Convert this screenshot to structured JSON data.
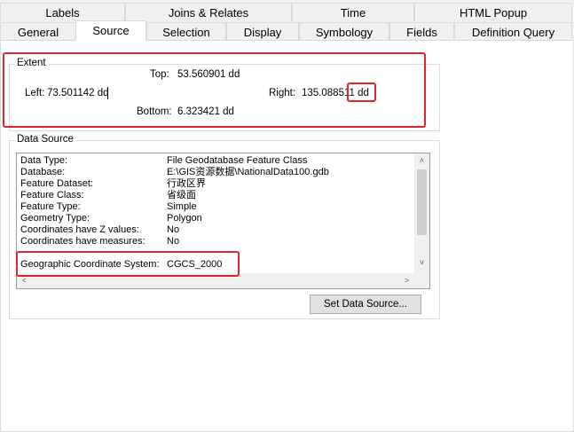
{
  "tabs_row1": [
    {
      "label": "Labels"
    },
    {
      "label": "Joins & Relates"
    },
    {
      "label": "Time"
    },
    {
      "label": "HTML Popup"
    }
  ],
  "tabs_row2": [
    {
      "label": "General"
    },
    {
      "label": "Source"
    },
    {
      "label": "Selection"
    },
    {
      "label": "Display"
    },
    {
      "label": "Symbology"
    },
    {
      "label": "Fields"
    },
    {
      "label": "Definition Query"
    }
  ],
  "active_tab": "Source",
  "extent": {
    "legend": "Extent",
    "top_label": "Top:",
    "top_value": "53.560901 dd",
    "left_label": "Left:",
    "left_value": "73.501142 dd",
    "right_label": "Right:",
    "right_value": "135.088511 dd",
    "bottom_label": "Bottom:",
    "bottom_value": "6.323421 dd"
  },
  "data_source": {
    "legend": "Data Source",
    "rows": [
      {
        "key": "Data Type:",
        "value": "File Geodatabase Feature Class"
      },
      {
        "key": "Database:",
        "value": "E:\\GIS资源数据\\NationalData100.gdb"
      },
      {
        "key": "Feature Dataset:",
        "value": "行政区界"
      },
      {
        "key": "Feature Class:",
        "value": "省级面"
      },
      {
        "key": "Feature Type:",
        "value": "Simple"
      },
      {
        "key": "Geometry Type:",
        "value": "Polygon"
      },
      {
        "key": "Coordinates have Z values:",
        "value": "No"
      },
      {
        "key": "Coordinates have measures:",
        "value": "No"
      },
      {
        "key": "Geographic Coordinate System:",
        "value": "CGCS_2000"
      }
    ],
    "button_label": "Set Data Source..."
  },
  "colors": {
    "highlight": "#e0262a"
  }
}
